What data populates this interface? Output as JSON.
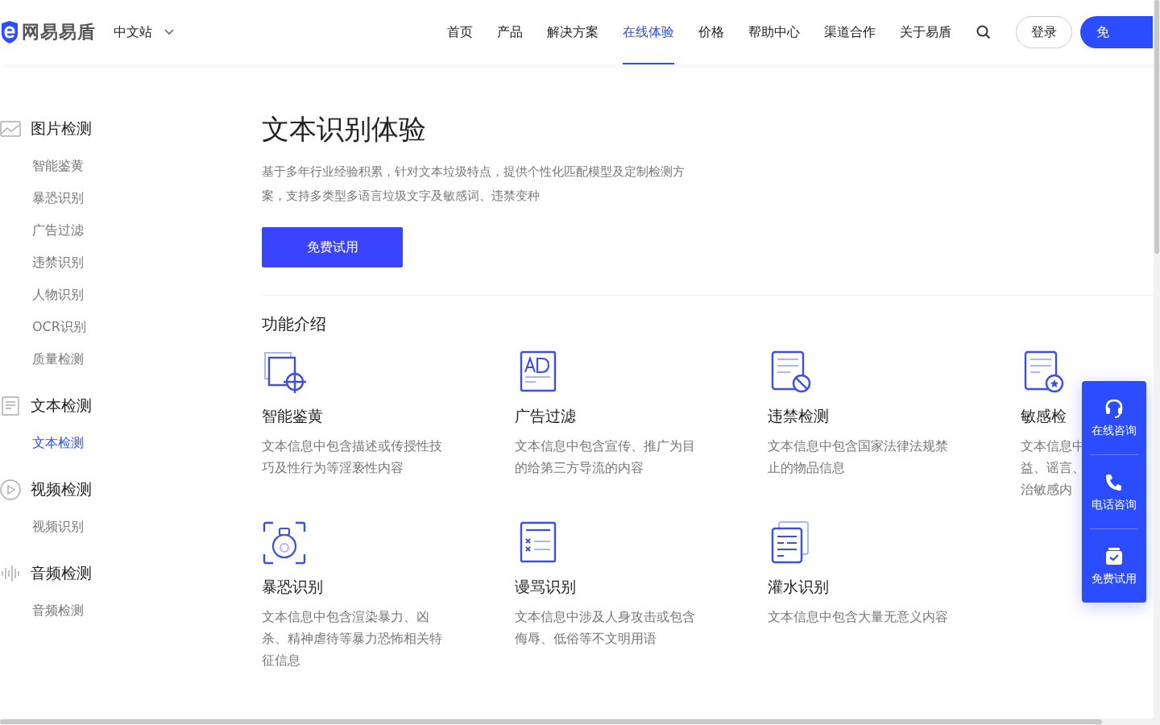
{
  "header": {
    "logo": "网易易盾",
    "site": "中文站",
    "nav": [
      {
        "label": "首页",
        "selected": false
      },
      {
        "label": "产品",
        "selected": false
      },
      {
        "label": "解决方案",
        "selected": false
      },
      {
        "label": "在线体验",
        "selected": true
      },
      {
        "label": "价格",
        "selected": false
      },
      {
        "label": "帮助中心",
        "selected": false
      },
      {
        "label": "渠道合作",
        "selected": false
      },
      {
        "label": "关于易盾",
        "selected": false
      }
    ],
    "login": "登录",
    "trial": "免"
  },
  "sidebar": [
    {
      "kind": "image",
      "title": "图片检测",
      "items": [
        {
          "label": "智能鉴黄",
          "selected": false
        },
        {
          "label": "暴恐识别",
          "selected": false
        },
        {
          "label": "广告过滤",
          "selected": false
        },
        {
          "label": "违禁识别",
          "selected": false
        },
        {
          "label": "人物识别",
          "selected": false
        },
        {
          "label": "OCR识别",
          "selected": false
        },
        {
          "label": "质量检测",
          "selected": false
        }
      ]
    },
    {
      "kind": "text",
      "title": "文本检测",
      "items": [
        {
          "label": "文本检测",
          "selected": true
        }
      ]
    },
    {
      "kind": "video",
      "title": "视频检测",
      "items": [
        {
          "label": "视频识别",
          "selected": false
        }
      ]
    },
    {
      "kind": "audio",
      "title": "音频检测",
      "items": [
        {
          "label": "音频检测",
          "selected": false
        }
      ]
    }
  ],
  "main": {
    "title": "文本识别体验",
    "intro": "基于多年行业经验积累，针对文本垃圾特点，提供个性化匹配模型及定制检测方案，支持多类型多语言垃圾文字及敏感词、违禁变种",
    "button": "免费试用",
    "section": "功能介绍",
    "features": [
      {
        "kind": "crosshair",
        "title": "智能鉴黄",
        "lines": [
          "文本信息中包含描述或传授性技巧及性行为等淫亵性内容"
        ]
      },
      {
        "kind": "ad",
        "title": "广告过滤",
        "lines": [
          "文本信息中包含宣传、推广为目的给第三方导流的内容"
        ]
      },
      {
        "kind": "ban",
        "title": "违禁检测",
        "lines": [
          "文本信息中包含国家法律法规禁止的物品信息"
        ]
      },
      {
        "kind": "star",
        "title": "敏感检",
        "lines": [
          "文本信息中",
          "益、谣言、",
          "治敏感内"
        ]
      },
      {
        "kind": "bomb",
        "title": "暴恐识别",
        "lines": [
          "文本信息中包含渲染暴力、凶杀、精神虐待等暴力恐怖相关特征信息"
        ]
      },
      {
        "kind": "list",
        "title": "谩骂识别",
        "lines": [
          "文本信息中涉及人身攻击或包含侮辱、低俗等不文明用语"
        ]
      },
      {
        "kind": "stack",
        "title": "灌水识别",
        "lines": [
          "文本信息中包含大量无意义内容"
        ]
      }
    ]
  },
  "float": [
    {
      "kind": "headset",
      "label": "在线咨询"
    },
    {
      "kind": "phone",
      "label": "电话咨询"
    },
    {
      "kind": "gift",
      "label": "免费试用"
    }
  ]
}
